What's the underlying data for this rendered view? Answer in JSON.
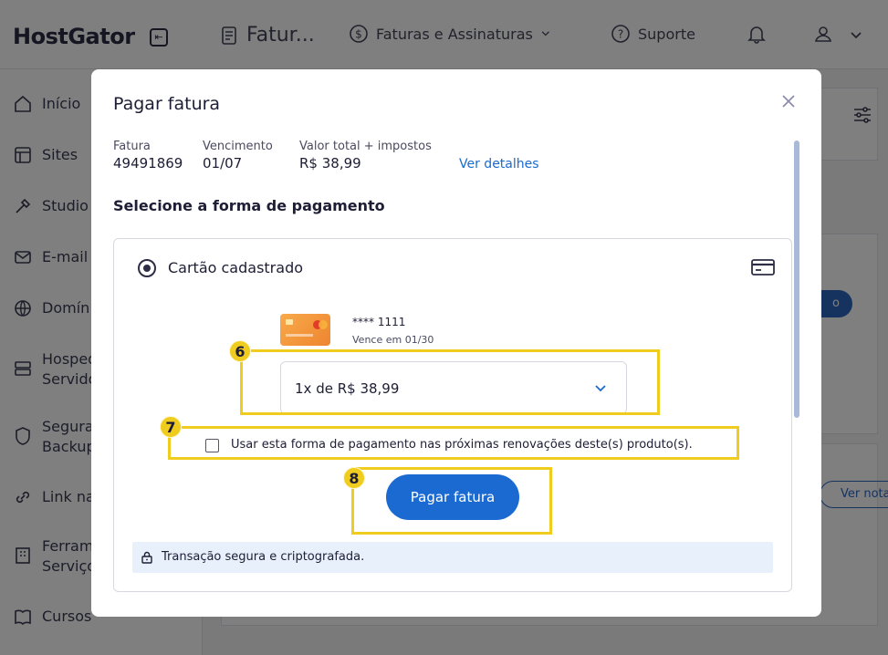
{
  "app": {
    "logo": "HostGator",
    "logo_button_glyph": "⇤",
    "nav": {
      "page_title": "Fatur...",
      "invoices_menu": "Faturas e Assinaturas",
      "support": "Suporte"
    }
  },
  "sidebar": {
    "items": [
      {
        "label": "Início",
        "icon": "home-icon"
      },
      {
        "label": "Sites",
        "icon": "layout-icon"
      },
      {
        "label": "Studio",
        "icon": "tools-icon"
      },
      {
        "label": "E-mail",
        "icon": "mail-icon"
      },
      {
        "label": "Domín",
        "icon": "globe-icon"
      },
      {
        "label": "Hosped",
        "label2": "Servido",
        "icon": "server-icon"
      },
      {
        "label": "Segura",
        "label2": "Backup",
        "icon": "shield-icon"
      },
      {
        "label": "Link na",
        "icon": "link-icon"
      },
      {
        "label": "Ferram",
        "label2": "Serviço",
        "icon": "building-icon"
      },
      {
        "label": "Cursos",
        "icon": "book-icon"
      }
    ]
  },
  "background": {
    "blue_button_partial": "o",
    "outline_button_partial": "Ver nota"
  },
  "modal": {
    "title": "Pagar fatura",
    "invoice": {
      "invoice_label": "Fatura",
      "invoice_value": "49491869",
      "due_label": "Vencimento",
      "due_value": "01/07",
      "total_label": "Valor total + impostos",
      "total_value": "R$ 38,99",
      "details_link": "Ver detalhes"
    },
    "section_title": "Selecione a forma de pagamento",
    "payment_option": {
      "label": "Cartão cadastrado",
      "selected": true,
      "card_number": "**** 1111",
      "card_expiry": "Vence em 01/30",
      "installment_value": "1x de R$ 38,99",
      "save_checkbox_label": "Usar esta forma de pagamento nas próximas renovações deste(s) produto(s).",
      "save_checkbox_checked": false,
      "pay_button": "Pagar fatura",
      "secure_text": "Transação segura e criptografada."
    }
  },
  "annotations": {
    "step6": "6",
    "step7": "7",
    "step8": "8",
    "highlight_color": "#f0cc1f"
  },
  "colors": {
    "primary": "#1a6ad1",
    "text": "#1d1d35",
    "banner_bg": "#e8f1fb"
  }
}
